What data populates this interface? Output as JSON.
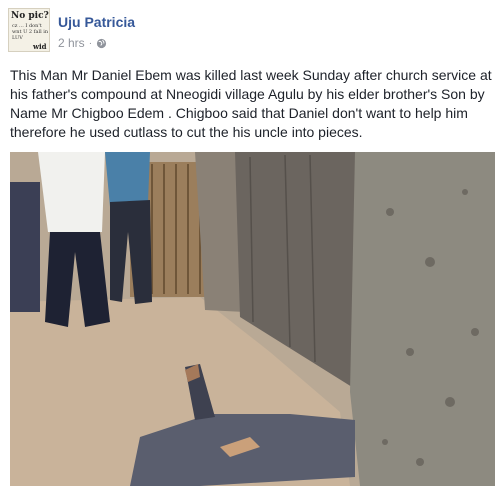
{
  "post": {
    "author": "Uju Patricia",
    "timestamp": "2 hrs",
    "privacy_icon": "globe-icon",
    "avatar_text": {
      "line1": "No pic?",
      "line2": "cz ... I don't wnt U 2 fall in LUV",
      "line3": "wid ME"
    },
    "text": "This Man Mr Daniel Ebem was killed last week Sunday after church service at his father's compound at Nneogidi village Agulu by his elder brother's Son by Name Mr Chigboo Edem . Chigboo said that Daniel don't want to help him therefore he used cutlass to cut the his uncle into pieces."
  },
  "colors": {
    "author_link": "#365899",
    "meta_text": "#90949c",
    "body_text": "#1d2129"
  }
}
